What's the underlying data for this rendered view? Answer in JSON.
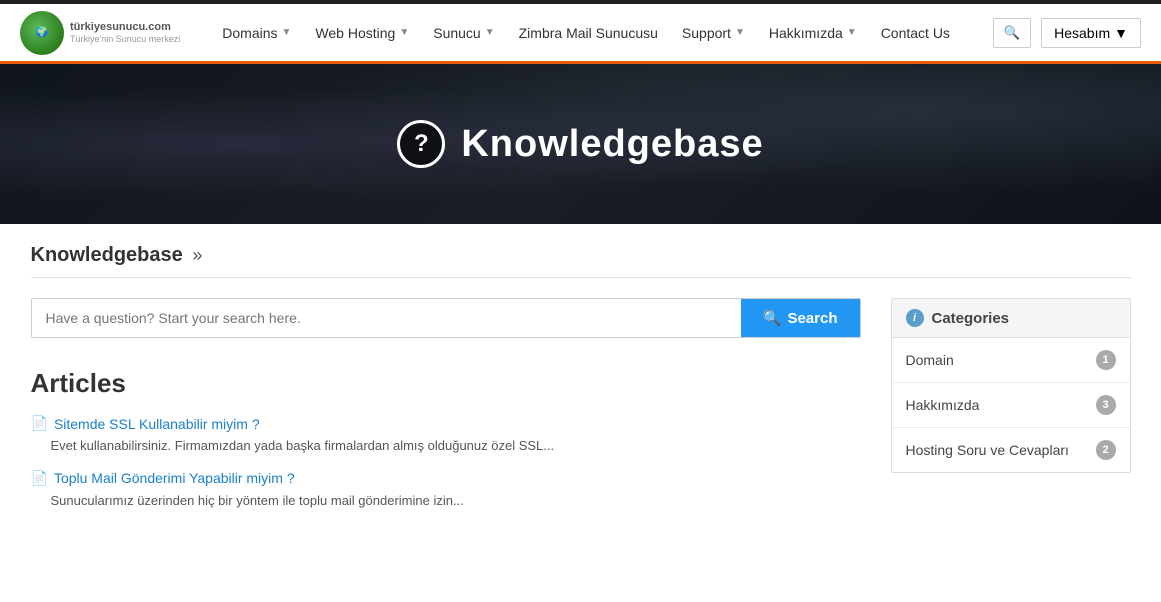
{
  "topbar": {},
  "nav": {
    "logo_text": "türkiyesunucu.com",
    "logo_sub": "Türkiye'nin Sunucu merkezi",
    "links": [
      {
        "label": "Domains",
        "has_dropdown": true
      },
      {
        "label": "Web Hosting",
        "has_dropdown": true
      },
      {
        "label": "Sunucu",
        "has_dropdown": true
      },
      {
        "label": "Zimbra Mail Sunucusu",
        "has_dropdown": false
      },
      {
        "label": "Support",
        "has_dropdown": true
      },
      {
        "label": "Hakkımızda",
        "has_dropdown": true
      },
      {
        "label": "Contact Us",
        "has_dropdown": false
      }
    ],
    "account_label": "Hesabım",
    "search_icon": "🔍"
  },
  "hero": {
    "title": "Knowledgebase",
    "icon_text": "?"
  },
  "breadcrumb": {
    "label": "Knowledgebase",
    "arrow": "»"
  },
  "search": {
    "placeholder": "Have a question? Start your search here.",
    "button_label": "Search",
    "search_icon": "🔍"
  },
  "articles": {
    "section_title": "Articles",
    "items": [
      {
        "title": "Sitemde SSL Kullanabilir miyim ?",
        "excerpt": "Evet kullanabilirsiniz. Firmamızdan yada başka firmalardan almış olduğunuz özel SSL..."
      },
      {
        "title": "Toplu Mail Gönderimi Yapabilir miyim ?",
        "excerpt": "Sunucularımız üzerinden hiç bir yöntem ile toplu mail gönderimine izin..."
      }
    ]
  },
  "sidebar": {
    "categories_label": "Categories",
    "info_icon": "i",
    "categories": [
      {
        "label": "Domain",
        "count": "1"
      },
      {
        "label": "Hakkımızda",
        "count": "3"
      },
      {
        "label": "Hosting Soru ve Cevapları",
        "count": "2"
      }
    ]
  }
}
